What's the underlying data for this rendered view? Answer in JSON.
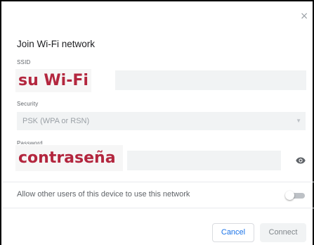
{
  "dialog": {
    "close_glyph": "×",
    "title": "Join Wi-Fi network",
    "ssid": {
      "label": "SSID",
      "overlay_text": "su Wi-Fi",
      "value": ""
    },
    "security": {
      "label": "Security",
      "selected": "PSK (WPA or RSN)",
      "arrow_glyph": "▼"
    },
    "password": {
      "label": "Password",
      "overlay_text": "contraseña",
      "value": "",
      "visibility_icon": "eye-icon"
    },
    "share": {
      "label": "Allow other users of this device to use this network",
      "enabled": false
    },
    "buttons": {
      "cancel": "Cancel",
      "connect": "Connect"
    }
  },
  "colors": {
    "overlay_text": "#b3263e",
    "accent": "#1a73e8",
    "field_bg": "#f1f3f4"
  }
}
